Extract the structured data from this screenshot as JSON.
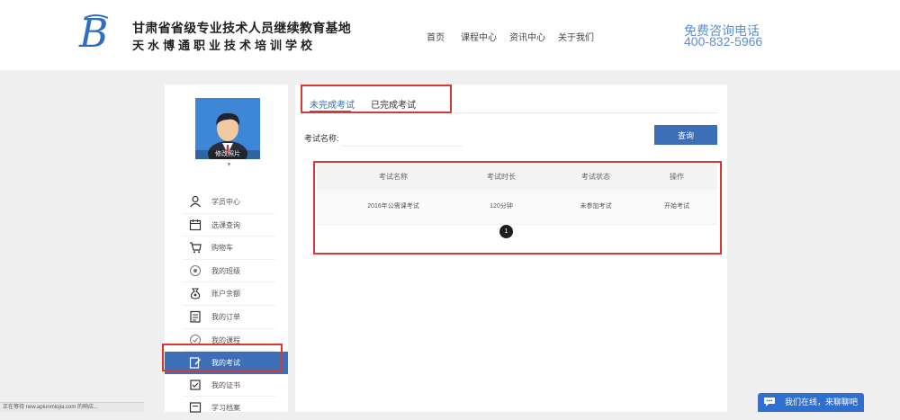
{
  "header": {
    "brand_line1": "甘肃省省级专业技术人员继续教育基地",
    "brand_line2": "天水博通职业技术培训学校",
    "nav": [
      "首页",
      "课程中心",
      "资讯中心",
      "关于我们"
    ],
    "phone_label": "免费咨询电话",
    "phone": "400-832-5966"
  },
  "sidebar": {
    "avatar_caption": "修改照片",
    "caret": "▼",
    "items": [
      {
        "label": "学员中心",
        "icon": "user-icon"
      },
      {
        "label": "选课查询",
        "icon": "calendar-icon"
      },
      {
        "label": "购物车",
        "icon": "cart-icon"
      },
      {
        "label": "我的班级",
        "icon": "class-icon"
      },
      {
        "label": "账户余额",
        "icon": "wallet-icon"
      },
      {
        "label": "我的订单",
        "icon": "order-icon"
      },
      {
        "label": "我的课程",
        "icon": "course-icon"
      },
      {
        "label": "我的考试",
        "icon": "exam-icon",
        "active": true
      },
      {
        "label": "我的证书",
        "icon": "certificate-icon"
      },
      {
        "label": "学习档案",
        "icon": "archive-icon"
      }
    ]
  },
  "main": {
    "tabs": [
      "未完成考试",
      "已完成考试"
    ],
    "search_label": "考试名称:",
    "search_value": "",
    "query_button": "查询",
    "table": {
      "headers": [
        "考试名称",
        "考试时长",
        "考试状态",
        "操作"
      ],
      "rows": [
        [
          "2016年公需课考试",
          "120分钟",
          "未参加考试",
          "开始考试"
        ]
      ]
    },
    "page": "1"
  },
  "status_bar": "正在等待 new.apiunmiojia.com 的响应...",
  "chat": {
    "label": "我们在线，来聊聊吧"
  },
  "colors": {
    "accent": "#3d6fb6",
    "highlight": "#d93838",
    "phone": "#5b8fd1"
  }
}
